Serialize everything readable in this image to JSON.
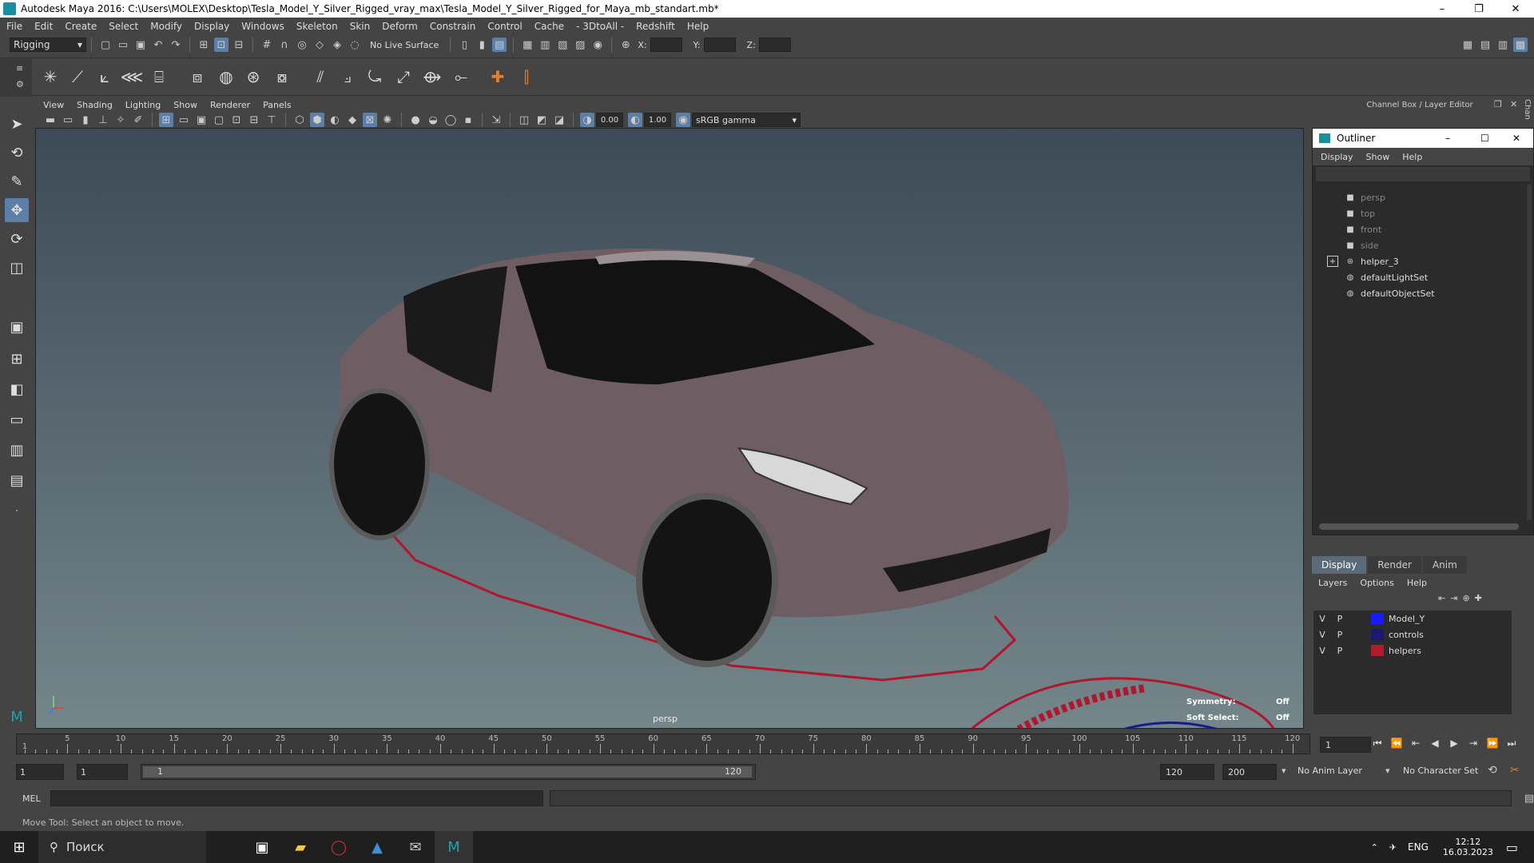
{
  "window": {
    "title": "Autodesk Maya 2016: C:\\Users\\MOLEX\\Desktop\\Tesla_Model_Y_Silver_Rigged_vray_max\\Tesla_Model_Y_Silver_Rigged_for_Maya_mb_standart.mb*",
    "minimize": "–",
    "restore": "❐",
    "close": "✕"
  },
  "menubar": [
    "File",
    "Edit",
    "Create",
    "Select",
    "Modify",
    "Display",
    "Windows",
    "Skeleton",
    "Skin",
    "Deform",
    "Constrain",
    "Control",
    "Cache",
    "- 3DtoAll -",
    "Redshift",
    "Help"
  ],
  "statusline": {
    "mode": "Rigging",
    "live_surface": "No Live Surface",
    "x_label": "X:",
    "y_label": "Y:",
    "z_label": "Z:"
  },
  "panel": {
    "menus": [
      "View",
      "Shading",
      "Lighting",
      "Show",
      "Renderer",
      "Panels"
    ],
    "exposure": "0.00",
    "gamma": "1.00",
    "color_space": "sRGB gamma"
  },
  "viewport": {
    "camera": "persp",
    "symmetry_label": "Symmetry:",
    "symmetry_value": "Off",
    "soft_select_label": "Soft Select:",
    "soft_select_value": "Off",
    "car_color": "#6e5d62"
  },
  "dock": {
    "header": "Channel Box / Layer Editor",
    "side_tab": "Chan"
  },
  "outliner": {
    "title": "Outliner",
    "menus": [
      "Display",
      "Show",
      "Help"
    ],
    "items": [
      {
        "label": "persp",
        "icon": "camera-icon",
        "dim": true
      },
      {
        "label": "top",
        "icon": "camera-icon",
        "dim": true
      },
      {
        "label": "front",
        "icon": "camera-icon",
        "dim": true
      },
      {
        "label": "side",
        "icon": "camera-icon",
        "dim": true
      },
      {
        "label": "helper_3",
        "icon": "group-icon",
        "dim": false
      },
      {
        "label": "defaultLightSet",
        "icon": "set-icon",
        "dim": false
      },
      {
        "label": "defaultObjectSet",
        "icon": "set-icon",
        "dim": false
      }
    ]
  },
  "layers": {
    "tabs": [
      "Display",
      "Render",
      "Anim"
    ],
    "menus": [
      "Layers",
      "Options",
      "Help"
    ],
    "rows": [
      {
        "v": "V",
        "p": "P",
        "color": "#1a1aff",
        "name": "Model_Y"
      },
      {
        "v": "V",
        "p": "P",
        "color": "#1a1a6e",
        "name": "controls"
      },
      {
        "v": "V",
        "p": "P",
        "color": "#b01c2a",
        "name": "helpers"
      }
    ]
  },
  "timeline": {
    "ticks": [
      "5",
      "10",
      "15",
      "20",
      "25",
      "30",
      "35",
      "40",
      "45",
      "50",
      "55",
      "60",
      "65",
      "70",
      "75",
      "80",
      "85",
      "90",
      "95",
      "100",
      "105",
      "110",
      "115",
      "120"
    ],
    "start_marker": "1",
    "current_frame": "1"
  },
  "range": {
    "start": "1",
    "anim_start": "1",
    "slider_start": "1",
    "slider_end": "120",
    "end": "120",
    "anim_end": "200",
    "anim_layer": "No Anim Layer",
    "character_set": "No Character Set"
  },
  "cmdline": {
    "label": "MEL"
  },
  "helpline": {
    "text": "Move Tool: Select an object to move."
  },
  "taskbar": {
    "search": "Поиск",
    "lang": "ENG",
    "time": "12:12",
    "date": "16.03.2023"
  }
}
